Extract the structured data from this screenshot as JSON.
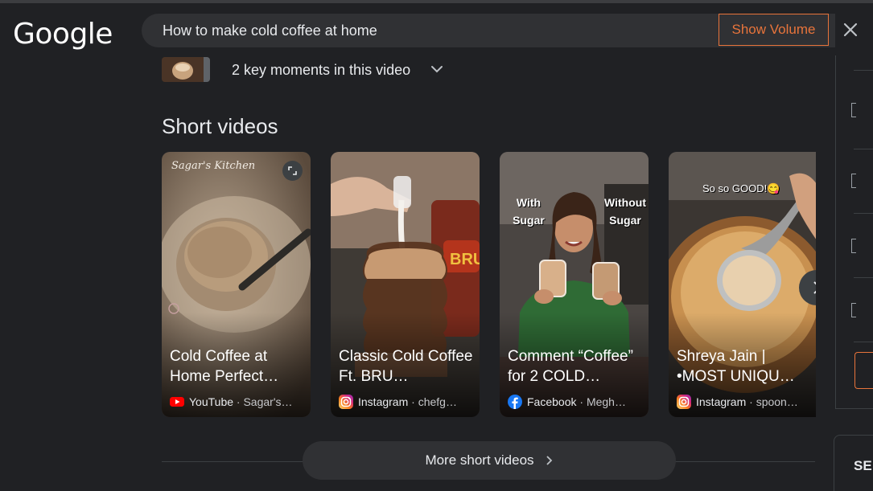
{
  "header": {
    "logo": "Google",
    "query": "How to make cold coffee at home",
    "show_volume_label": "Show Volume",
    "accent_color": "#e8743b"
  },
  "key_moments": {
    "label": "2 key moments in this video"
  },
  "short_videos": {
    "heading": "Short videos",
    "cards": [
      {
        "title": "Cold Coffee at Home Perfect…",
        "platform": "YouTube",
        "author": "Sagar's…",
        "platform_icon": "youtube-icon",
        "overlay_text": "Sagar's Kitchen"
      },
      {
        "title": "Classic Cold Coffee Ft. BRU…",
        "platform": "Instagram",
        "author": "chefg…",
        "platform_icon": "instagram-icon",
        "overlay_text": "BRU"
      },
      {
        "title": "Comment “Coffee” for 2 COLD…",
        "platform": "Facebook",
        "author": "Megh…",
        "platform_icon": "facebook-icon",
        "overlay_text_left": "With Sugar",
        "overlay_text_right": "Without Sugar"
      },
      {
        "title": "Shreya Jain | •MOST UNIQU…",
        "platform": "Instagram",
        "author": "spoon…",
        "platform_icon": "instagram-icon",
        "overlay_text": "So so GOOD!😋"
      }
    ],
    "more_label": "More short videos"
  },
  "right_panel": {
    "partial_label": "SE"
  }
}
